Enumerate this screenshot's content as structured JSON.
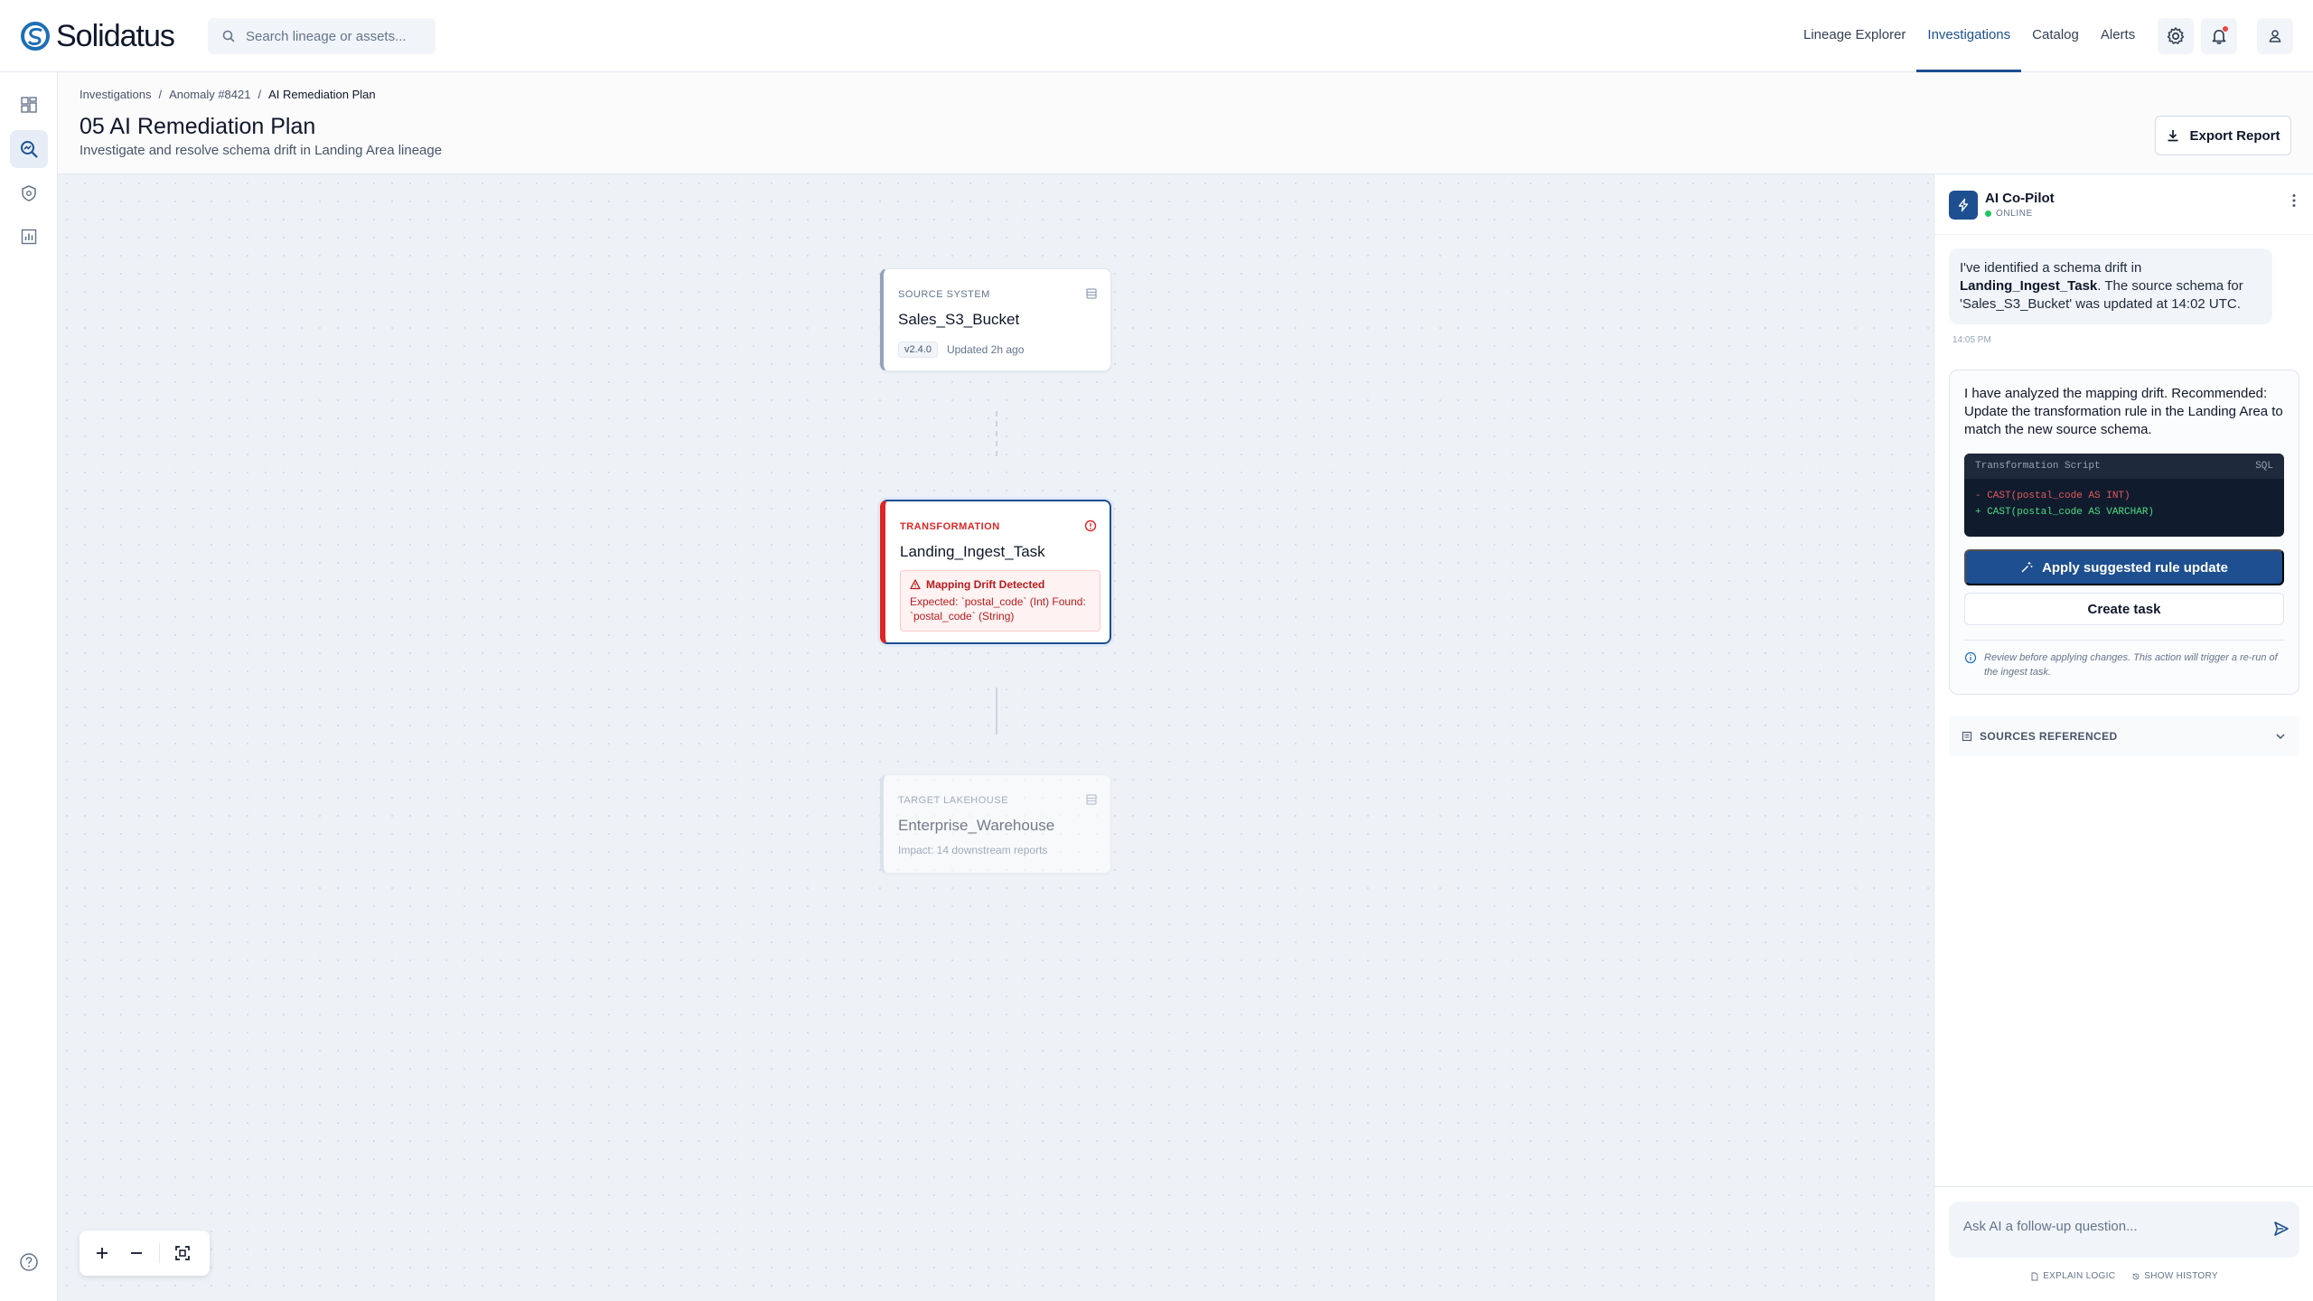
{
  "app": {
    "brand": "Solidatus"
  },
  "search": {
    "placeholder": "Search lineage or assets..."
  },
  "nav": {
    "items": [
      {
        "label": "Lineage Explorer",
        "active": false
      },
      {
        "label": "Investigations",
        "active": true
      },
      {
        "label": "Catalog",
        "active": false
      },
      {
        "label": "Alerts",
        "active": false
      }
    ]
  },
  "breadcrumb": [
    "Investigations",
    "Anomaly #8421",
    "AI Remediation Plan"
  ],
  "page": {
    "title": "05 AI Remediation Plan",
    "subtitle": "Investigate and resolve schema drift in Landing Area lineage",
    "export_label": "Export Report"
  },
  "nodes": {
    "source": {
      "kind": "Source System",
      "name": "Sales_S3_Bucket",
      "version": "v2.4.0",
      "updated": "Updated 2h ago"
    },
    "transform": {
      "kind": "Transformation",
      "name": "Landing_Ingest_Task",
      "alert_title": "Mapping Drift Detected",
      "alert_text": "Expected: `postal_code` (Int) Found: `postal_code` (String)"
    },
    "target": {
      "kind": "Target Lakehouse",
      "name": "Enterprise_Warehouse",
      "impact": "Impact: 14 downstream reports"
    }
  },
  "copilot": {
    "name": "AI Co-Pilot",
    "status": "ONLINE",
    "message_prefix": "I've identified a schema drift in ",
    "message_bold": "Landing_Ingest_Task",
    "message_suffix": ". The source schema for 'Sales_S3_Bucket' was updated at 14:02 UTC.",
    "message_time": "14:05 PM",
    "recommendation": "I have analyzed the mapping drift. Recommended: Update the transformation rule in the Landing Area to match the new source schema.",
    "code_title": "Transformation Script",
    "code_lang": "SQL",
    "code_removed": "- CAST(postal_code AS INT)",
    "code_added": "+ CAST(postal_code AS VARCHAR)",
    "apply_label": "Apply suggested rule update",
    "task_label": "Create task",
    "note": "Review before applying changes. This action will trigger a re-run of the ingest task.",
    "sources_label": "SOURCES REFERENCED",
    "ask_placeholder": "Ask AI a follow-up question...",
    "explain_label": "EXPLAIN LOGIC",
    "history_label": "SHOW HISTORY"
  },
  "colors": {
    "accent": "#1d4f91",
    "danger": "#dc2626",
    "success": "#22c55e",
    "canvas": "#eef2f7"
  }
}
